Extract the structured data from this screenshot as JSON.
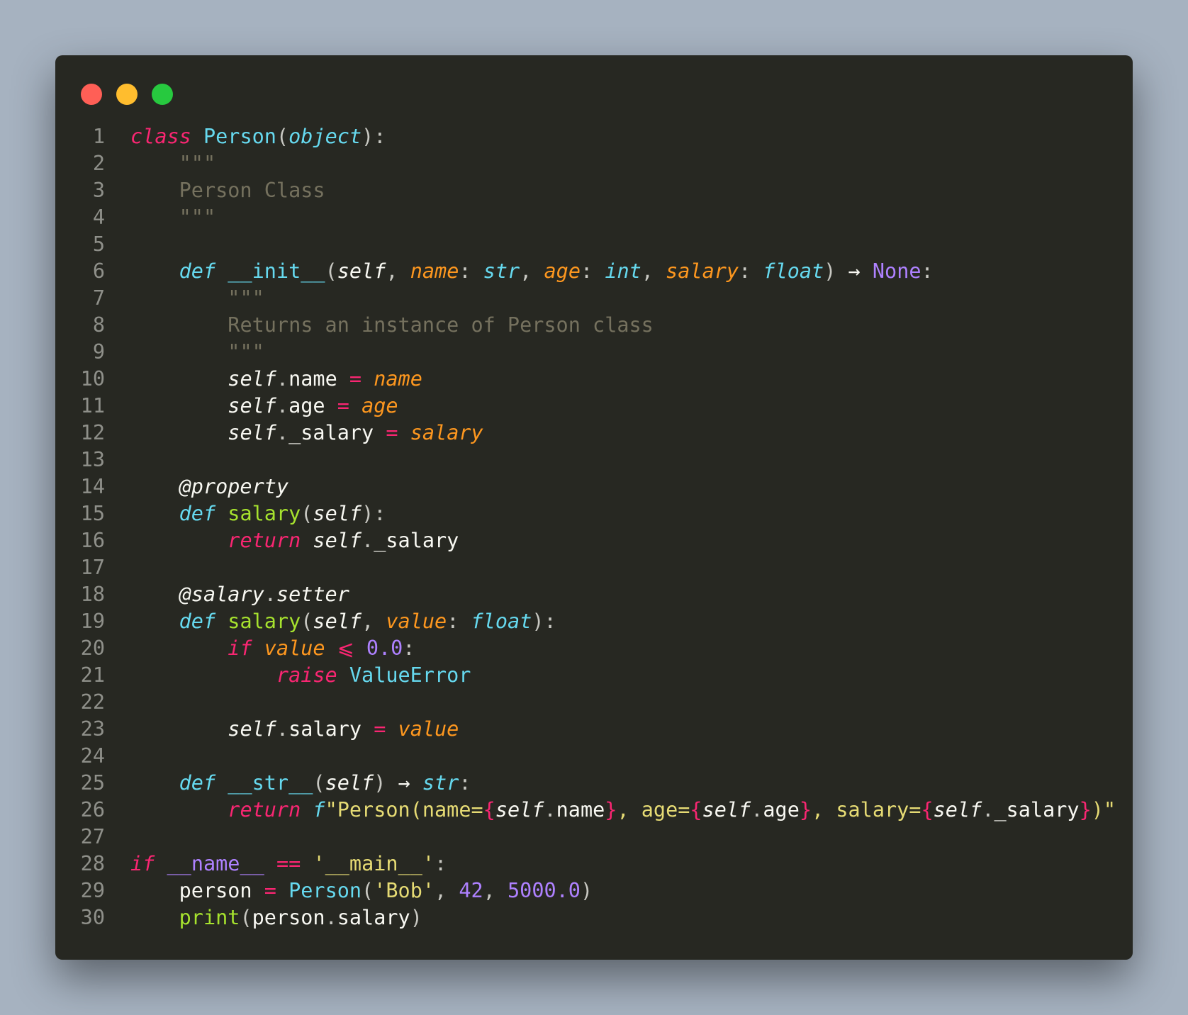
{
  "window": {
    "buttons": [
      {
        "name": "close",
        "color": "#ff5f56"
      },
      {
        "name": "minimize",
        "color": "#ffbd2e"
      },
      {
        "name": "zoom",
        "color": "#27c93f"
      }
    ]
  },
  "code": {
    "language": "python",
    "lines": [
      {
        "n": "1",
        "t": [
          [
            "kw",
            "class"
          ],
          [
            "tx",
            " "
          ],
          [
            "ty",
            "Person"
          ],
          [
            "pun",
            "("
          ],
          [
            "st",
            "object"
          ],
          [
            "pun",
            "):"
          ]
        ]
      },
      {
        "n": "2",
        "t": [
          [
            "tx",
            "    "
          ],
          [
            "cm",
            "\"\"\""
          ]
        ]
      },
      {
        "n": "3",
        "t": [
          [
            "tx",
            "    "
          ],
          [
            "cm",
            "Person Class"
          ]
        ]
      },
      {
        "n": "4",
        "t": [
          [
            "tx",
            "    "
          ],
          [
            "cm",
            "\"\"\""
          ]
        ]
      },
      {
        "n": "5",
        "t": []
      },
      {
        "n": "6",
        "t": [
          [
            "tx",
            "    "
          ],
          [
            "st",
            "def"
          ],
          [
            "tx",
            " "
          ],
          [
            "ty",
            "__init__"
          ],
          [
            "pun",
            "("
          ],
          [
            "sf",
            "self"
          ],
          [
            "pun",
            ", "
          ],
          [
            "ar",
            "name"
          ],
          [
            "pun",
            ": "
          ],
          [
            "st",
            "str"
          ],
          [
            "pun",
            ", "
          ],
          [
            "ar",
            "age"
          ],
          [
            "pun",
            ": "
          ],
          [
            "st",
            "int"
          ],
          [
            "pun",
            ", "
          ],
          [
            "ar",
            "salary"
          ],
          [
            "pun",
            ": "
          ],
          [
            "st",
            "float"
          ],
          [
            "pun",
            ") "
          ],
          [
            "tx",
            "→"
          ],
          [
            "tx",
            " "
          ],
          [
            "num",
            "None"
          ],
          [
            "pun",
            ":"
          ]
        ]
      },
      {
        "n": "7",
        "t": [
          [
            "tx",
            "        "
          ],
          [
            "cm",
            "\"\"\""
          ]
        ]
      },
      {
        "n": "8",
        "t": [
          [
            "tx",
            "        "
          ],
          [
            "cm",
            "Returns an instance of Person class"
          ]
        ]
      },
      {
        "n": "9",
        "t": [
          [
            "tx",
            "        "
          ],
          [
            "cm",
            "\"\"\""
          ]
        ]
      },
      {
        "n": "10",
        "t": [
          [
            "tx",
            "        "
          ],
          [
            "sf",
            "self"
          ],
          [
            "pun",
            "."
          ],
          [
            "tx",
            "name "
          ],
          [
            "op",
            "="
          ],
          [
            "tx",
            " "
          ],
          [
            "ar",
            "name"
          ]
        ]
      },
      {
        "n": "11",
        "t": [
          [
            "tx",
            "        "
          ],
          [
            "sf",
            "self"
          ],
          [
            "pun",
            "."
          ],
          [
            "tx",
            "age "
          ],
          [
            "op",
            "="
          ],
          [
            "tx",
            " "
          ],
          [
            "ar",
            "age"
          ]
        ]
      },
      {
        "n": "12",
        "t": [
          [
            "tx",
            "        "
          ],
          [
            "sf",
            "self"
          ],
          [
            "pun",
            "."
          ],
          [
            "tx",
            "_salary "
          ],
          [
            "op",
            "="
          ],
          [
            "tx",
            " "
          ],
          [
            "ar",
            "salary"
          ]
        ]
      },
      {
        "n": "13",
        "t": []
      },
      {
        "n": "14",
        "t": [
          [
            "tx",
            "    "
          ],
          [
            "dec",
            "@property"
          ]
        ]
      },
      {
        "n": "15",
        "t": [
          [
            "tx",
            "    "
          ],
          [
            "st",
            "def"
          ],
          [
            "tx",
            " "
          ],
          [
            "fn",
            "salary"
          ],
          [
            "pun",
            "("
          ],
          [
            "sf",
            "self"
          ],
          [
            "pun",
            "):"
          ]
        ]
      },
      {
        "n": "16",
        "t": [
          [
            "tx",
            "        "
          ],
          [
            "kw",
            "return"
          ],
          [
            "tx",
            " "
          ],
          [
            "sf",
            "self"
          ],
          [
            "pun",
            "."
          ],
          [
            "tx",
            "_salary"
          ]
        ]
      },
      {
        "n": "17",
        "t": []
      },
      {
        "n": "18",
        "t": [
          [
            "tx",
            "    "
          ],
          [
            "dec",
            "@salary"
          ],
          [
            "pun",
            "."
          ],
          [
            "dec",
            "setter"
          ]
        ]
      },
      {
        "n": "19",
        "t": [
          [
            "tx",
            "    "
          ],
          [
            "st",
            "def"
          ],
          [
            "tx",
            " "
          ],
          [
            "fn",
            "salary"
          ],
          [
            "pun",
            "("
          ],
          [
            "sf",
            "self"
          ],
          [
            "pun",
            ", "
          ],
          [
            "ar",
            "value"
          ],
          [
            "pun",
            ": "
          ],
          [
            "st",
            "float"
          ],
          [
            "pun",
            "):"
          ]
        ]
      },
      {
        "n": "20",
        "t": [
          [
            "tx",
            "        "
          ],
          [
            "kw",
            "if"
          ],
          [
            "tx",
            " "
          ],
          [
            "ar",
            "value"
          ],
          [
            "tx",
            " "
          ],
          [
            "op",
            "⩽"
          ],
          [
            "tx",
            " "
          ],
          [
            "num",
            "0.0"
          ],
          [
            "pun",
            ":"
          ]
        ]
      },
      {
        "n": "21",
        "t": [
          [
            "tx",
            "            "
          ],
          [
            "kw",
            "raise"
          ],
          [
            "tx",
            " "
          ],
          [
            "ty",
            "ValueError"
          ]
        ]
      },
      {
        "n": "22",
        "t": []
      },
      {
        "n": "23",
        "t": [
          [
            "tx",
            "        "
          ],
          [
            "sf",
            "self"
          ],
          [
            "pun",
            "."
          ],
          [
            "tx",
            "salary "
          ],
          [
            "op",
            "="
          ],
          [
            "tx",
            " "
          ],
          [
            "ar",
            "value"
          ]
        ]
      },
      {
        "n": "24",
        "t": []
      },
      {
        "n": "25",
        "t": [
          [
            "tx",
            "    "
          ],
          [
            "st",
            "def"
          ],
          [
            "tx",
            " "
          ],
          [
            "ty",
            "__str__"
          ],
          [
            "pun",
            "("
          ],
          [
            "sf",
            "self"
          ],
          [
            "pun",
            ") "
          ],
          [
            "tx",
            "→"
          ],
          [
            "tx",
            " "
          ],
          [
            "st",
            "str"
          ],
          [
            "pun",
            ":"
          ]
        ]
      },
      {
        "n": "26",
        "t": [
          [
            "tx",
            "        "
          ],
          [
            "kw",
            "return"
          ],
          [
            "tx",
            " "
          ],
          [
            "st",
            "f"
          ],
          [
            "str",
            "\"Person(name="
          ],
          [
            "op",
            "{"
          ],
          [
            "sf",
            "self"
          ],
          [
            "pun",
            "."
          ],
          [
            "tx",
            "name"
          ],
          [
            "op",
            "}"
          ],
          [
            "str",
            ", age="
          ],
          [
            "op",
            "{"
          ],
          [
            "sf",
            "self"
          ],
          [
            "pun",
            "."
          ],
          [
            "tx",
            "age"
          ],
          [
            "op",
            "}"
          ],
          [
            "str",
            ", salary="
          ],
          [
            "op",
            "{"
          ],
          [
            "sf",
            "self"
          ],
          [
            "pun",
            "."
          ],
          [
            "tx",
            "_salary"
          ],
          [
            "op",
            "}"
          ],
          [
            "str",
            ")\""
          ]
        ]
      },
      {
        "n": "27",
        "t": []
      },
      {
        "n": "28",
        "t": [
          [
            "kw",
            "if"
          ],
          [
            "tx",
            " "
          ],
          [
            "num",
            "__name__"
          ],
          [
            "tx",
            " "
          ],
          [
            "op",
            "=="
          ],
          [
            "tx",
            " "
          ],
          [
            "str",
            "'__main__'"
          ],
          [
            "pun",
            ":"
          ]
        ]
      },
      {
        "n": "29",
        "t": [
          [
            "tx",
            "    "
          ],
          [
            "tx",
            "person "
          ],
          [
            "op",
            "="
          ],
          [
            "tx",
            " "
          ],
          [
            "ty",
            "Person"
          ],
          [
            "pun",
            "("
          ],
          [
            "str",
            "'Bob'"
          ],
          [
            "pun",
            ", "
          ],
          [
            "num",
            "42"
          ],
          [
            "pun",
            ", "
          ],
          [
            "num",
            "5000.0"
          ],
          [
            "pun",
            ")"
          ]
        ]
      },
      {
        "n": "30",
        "t": [
          [
            "tx",
            "    "
          ],
          [
            "fn",
            "print"
          ],
          [
            "pun",
            "("
          ],
          [
            "tx",
            "person"
          ],
          [
            "pun",
            "."
          ],
          [
            "tx",
            "salary"
          ],
          [
            "pun",
            ")"
          ]
        ]
      }
    ]
  }
}
